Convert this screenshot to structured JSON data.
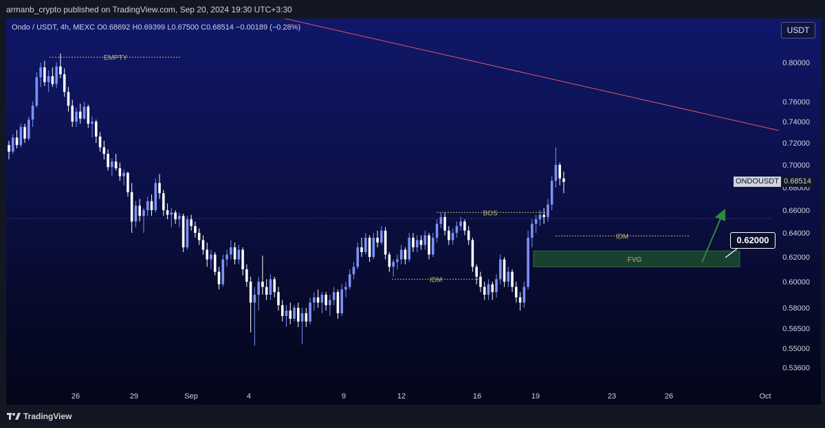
{
  "header": {
    "published_by": "armanb_crypto published on TradingView.com, Sep 20, 2024 19:30 UTC+3:30"
  },
  "legend": {
    "text": "Ondo / USDT, 4h, MEXC  O0.68692  H0.69399  L0.67500  C0.68514  −0.00189 (−0.28%)"
  },
  "currency_button": "USDT",
  "symbol_tag": "ONDOUSDT",
  "price_tag": "0.68514",
  "callout_value": "0.62000",
  "footer": {
    "brand": "TradingView"
  },
  "colors": {
    "candle_up": "#7b93f5",
    "candle_down": "#ffffff",
    "trendline": "#e3566b",
    "annotation": "#c8ba64",
    "zone": "#1d4a2f",
    "arrow": "#2d8a3c"
  },
  "chart_data": {
    "type": "candlestick",
    "title": "Ondo / USDT, 4h, MEXC",
    "y_axis_ticks": [
      "0.80000",
      "0.76000",
      "0.74000",
      "0.72000",
      "0.70000",
      "0.68000",
      "0.66000",
      "0.64000",
      "0.62000",
      "0.60000",
      "0.58000",
      "0.56500",
      "0.55000",
      "0.53600"
    ],
    "x_axis_ticks": [
      "26",
      "29",
      "Sep",
      "4",
      "9",
      "12",
      "16",
      "19",
      "23",
      "26",
      "Oct"
    ],
    "current_price": 0.68514,
    "annotations": [
      {
        "label": "EMPTY",
        "price": 0.806
      },
      {
        "label": "BOS",
        "price": 0.658
      },
      {
        "label": "IDM",
        "price": 0.6375
      },
      {
        "label": "IDM",
        "price": 0.602
      },
      {
        "label": "FVG",
        "price_low": 0.612,
        "price_high": 0.625
      }
    ],
    "callout": {
      "value": "0.62000"
    },
    "candles": [
      [
        0.718,
        0.722,
        0.705,
        0.712
      ],
      [
        0.712,
        0.728,
        0.71,
        0.725
      ],
      [
        0.725,
        0.732,
        0.715,
        0.718
      ],
      [
        0.718,
        0.738,
        0.716,
        0.735
      ],
      [
        0.735,
        0.738,
        0.72,
        0.724
      ],
      [
        0.724,
        0.745,
        0.722,
        0.742
      ],
      [
        0.742,
        0.76,
        0.735,
        0.756
      ],
      [
        0.756,
        0.79,
        0.754,
        0.785
      ],
      [
        0.785,
        0.8,
        0.775,
        0.795
      ],
      [
        0.795,
        0.802,
        0.776,
        0.78
      ],
      [
        0.78,
        0.792,
        0.77,
        0.786
      ],
      [
        0.786,
        0.795,
        0.775,
        0.778
      ],
      [
        0.778,
        0.8,
        0.774,
        0.796
      ],
      [
        0.796,
        0.81,
        0.784,
        0.788
      ],
      [
        0.788,
        0.794,
        0.765,
        0.77
      ],
      [
        0.77,
        0.775,
        0.75,
        0.756
      ],
      [
        0.756,
        0.762,
        0.735,
        0.74
      ],
      [
        0.74,
        0.754,
        0.735,
        0.75
      ],
      [
        0.75,
        0.758,
        0.738,
        0.743
      ],
      [
        0.743,
        0.76,
        0.742,
        0.755
      ],
      [
        0.755,
        0.757,
        0.734,
        0.738
      ],
      [
        0.738,
        0.745,
        0.725,
        0.74
      ],
      [
        0.74,
        0.742,
        0.72,
        0.726
      ],
      [
        0.726,
        0.73,
        0.712,
        0.716
      ],
      [
        0.716,
        0.722,
        0.705,
        0.71
      ],
      [
        0.71,
        0.714,
        0.695,
        0.698
      ],
      [
        0.698,
        0.706,
        0.69,
        0.703
      ],
      [
        0.703,
        0.71,
        0.695,
        0.697
      ],
      [
        0.697,
        0.702,
        0.686,
        0.69
      ],
      [
        0.69,
        0.696,
        0.682,
        0.693
      ],
      [
        0.693,
        0.694,
        0.672,
        0.676
      ],
      [
        0.676,
        0.684,
        0.64,
        0.65
      ],
      [
        0.65,
        0.668,
        0.645,
        0.664
      ],
      [
        0.664,
        0.67,
        0.65,
        0.655
      ],
      [
        0.655,
        0.662,
        0.64,
        0.66
      ],
      [
        0.66,
        0.672,
        0.655,
        0.668
      ],
      [
        0.668,
        0.674,
        0.655,
        0.66
      ],
      [
        0.66,
        0.688,
        0.658,
        0.684
      ],
      [
        0.684,
        0.692,
        0.67,
        0.675
      ],
      [
        0.675,
        0.678,
        0.655,
        0.66
      ],
      [
        0.66,
        0.666,
        0.652,
        0.656
      ],
      [
        0.656,
        0.662,
        0.645,
        0.658
      ],
      [
        0.658,
        0.66,
        0.648,
        0.652
      ],
      [
        0.652,
        0.658,
        0.645,
        0.655
      ],
      [
        0.655,
        0.657,
        0.624,
        0.628
      ],
      [
        0.628,
        0.655,
        0.626,
        0.652
      ],
      [
        0.652,
        0.656,
        0.642,
        0.646
      ],
      [
        0.646,
        0.65,
        0.636,
        0.64
      ],
      [
        0.64,
        0.644,
        0.63,
        0.634
      ],
      [
        0.634,
        0.638,
        0.622,
        0.626
      ],
      [
        0.626,
        0.632,
        0.612,
        0.618
      ],
      [
        0.618,
        0.626,
        0.61,
        0.622
      ],
      [
        0.622,
        0.624,
        0.605,
        0.608
      ],
      [
        0.608,
        0.612,
        0.594,
        0.598
      ],
      [
        0.598,
        0.622,
        0.596,
        0.618
      ],
      [
        0.618,
        0.626,
        0.612,
        0.622
      ],
      [
        0.622,
        0.634,
        0.618,
        0.628
      ],
      [
        0.628,
        0.632,
        0.614,
        0.618
      ],
      [
        0.618,
        0.63,
        0.614,
        0.626
      ],
      [
        0.626,
        0.628,
        0.605,
        0.61
      ],
      [
        0.61,
        0.614,
        0.596,
        0.6
      ],
      [
        0.6,
        0.604,
        0.562,
        0.584
      ],
      [
        0.584,
        0.596,
        0.552,
        0.59
      ],
      [
        0.59,
        0.604,
        0.578,
        0.6
      ],
      [
        0.6,
        0.621,
        0.59,
        0.596
      ],
      [
        0.596,
        0.602,
        0.586,
        0.59
      ],
      [
        0.59,
        0.606,
        0.586,
        0.602
      ],
      [
        0.602,
        0.604,
        0.588,
        0.592
      ],
      [
        0.592,
        0.596,
        0.578,
        0.582
      ],
      [
        0.582,
        0.586,
        0.57,
        0.574
      ],
      [
        0.574,
        0.582,
        0.566,
        0.578
      ],
      [
        0.578,
        0.584,
        0.568,
        0.572
      ],
      [
        0.572,
        0.582,
        0.57,
        0.58
      ],
      [
        0.58,
        0.584,
        0.566,
        0.57
      ],
      [
        0.57,
        0.58,
        0.553,
        0.576
      ],
      [
        0.576,
        0.58,
        0.566,
        0.57
      ],
      [
        0.57,
        0.588,
        0.568,
        0.584
      ],
      [
        0.584,
        0.592,
        0.578,
        0.588
      ],
      [
        0.588,
        0.594,
        0.58,
        0.584
      ],
      [
        0.584,
        0.592,
        0.576,
        0.59
      ],
      [
        0.59,
        0.592,
        0.578,
        0.582
      ],
      [
        0.582,
        0.59,
        0.574,
        0.586
      ],
      [
        0.586,
        0.596,
        0.582,
        0.592
      ],
      [
        0.592,
        0.594,
        0.572,
        0.576
      ],
      [
        0.576,
        0.598,
        0.574,
        0.594
      ],
      [
        0.594,
        0.6,
        0.588,
        0.596
      ],
      [
        0.596,
        0.61,
        0.594,
        0.606
      ],
      [
        0.606,
        0.616,
        0.602,
        0.612
      ],
      [
        0.612,
        0.632,
        0.61,
        0.628
      ],
      [
        0.628,
        0.636,
        0.62,
        0.624
      ],
      [
        0.624,
        0.64,
        0.622,
        0.636
      ],
      [
        0.636,
        0.638,
        0.616,
        0.62
      ],
      [
        0.62,
        0.64,
        0.618,
        0.636
      ],
      [
        0.636,
        0.642,
        0.628,
        0.632
      ],
      [
        0.632,
        0.646,
        0.63,
        0.642
      ],
      [
        0.642,
        0.645,
        0.618,
        0.622
      ],
      [
        0.622,
        0.624,
        0.608,
        0.612
      ],
      [
        0.612,
        0.618,
        0.604,
        0.616
      ],
      [
        0.616,
        0.622,
        0.61,
        0.618
      ],
      [
        0.618,
        0.63,
        0.614,
        0.626
      ],
      [
        0.626,
        0.628,
        0.614,
        0.618
      ],
      [
        0.618,
        0.64,
        0.616,
        0.636
      ],
      [
        0.636,
        0.64,
        0.624,
        0.628
      ],
      [
        0.628,
        0.638,
        0.624,
        0.634
      ],
      [
        0.634,
        0.638,
        0.626,
        0.63
      ],
      [
        0.63,
        0.642,
        0.626,
        0.638
      ],
      [
        0.638,
        0.64,
        0.618,
        0.622
      ],
      [
        0.622,
        0.64,
        0.62,
        0.636
      ],
      [
        0.636,
        0.652,
        0.632,
        0.648
      ],
      [
        0.648,
        0.658,
        0.644,
        0.654
      ],
      [
        0.654,
        0.658,
        0.638,
        0.642
      ],
      [
        0.642,
        0.646,
        0.63,
        0.634
      ],
      [
        0.634,
        0.644,
        0.63,
        0.64
      ],
      [
        0.64,
        0.65,
        0.636,
        0.646
      ],
      [
        0.646,
        0.654,
        0.642,
        0.65
      ],
      [
        0.65,
        0.652,
        0.638,
        0.642
      ],
      [
        0.642,
        0.646,
        0.63,
        0.634
      ],
      [
        0.634,
        0.636,
        0.608,
        0.612
      ],
      [
        0.612,
        0.614,
        0.598,
        0.604
      ],
      [
        0.604,
        0.608,
        0.592,
        0.596
      ],
      [
        0.596,
        0.6,
        0.586,
        0.59
      ],
      [
        0.59,
        0.602,
        0.586,
        0.598
      ],
      [
        0.598,
        0.6,
        0.586,
        0.592
      ],
      [
        0.592,
        0.606,
        0.588,
        0.602
      ],
      [
        0.602,
        0.622,
        0.598,
        0.618
      ],
      [
        0.618,
        0.62,
        0.596,
        0.6
      ],
      [
        0.6,
        0.612,
        0.596,
        0.608
      ],
      [
        0.608,
        0.61,
        0.592,
        0.596
      ],
      [
        0.596,
        0.6,
        0.584,
        0.588
      ],
      [
        0.588,
        0.592,
        0.578,
        0.584
      ],
      [
        0.584,
        0.6,
        0.58,
        0.596
      ],
      [
        0.596,
        0.642,
        0.594,
        0.636
      ],
      [
        0.636,
        0.652,
        0.628,
        0.648
      ],
      [
        0.648,
        0.656,
        0.64,
        0.652
      ],
      [
        0.652,
        0.66,
        0.646,
        0.656
      ],
      [
        0.656,
        0.662,
        0.648,
        0.654
      ],
      [
        0.654,
        0.67,
        0.65,
        0.665
      ],
      [
        0.665,
        0.69,
        0.66,
        0.686
      ],
      [
        0.686,
        0.716,
        0.68,
        0.7
      ],
      [
        0.7,
        0.702,
        0.682,
        0.688
      ],
      [
        0.688,
        0.694,
        0.675,
        0.685
      ]
    ]
  }
}
